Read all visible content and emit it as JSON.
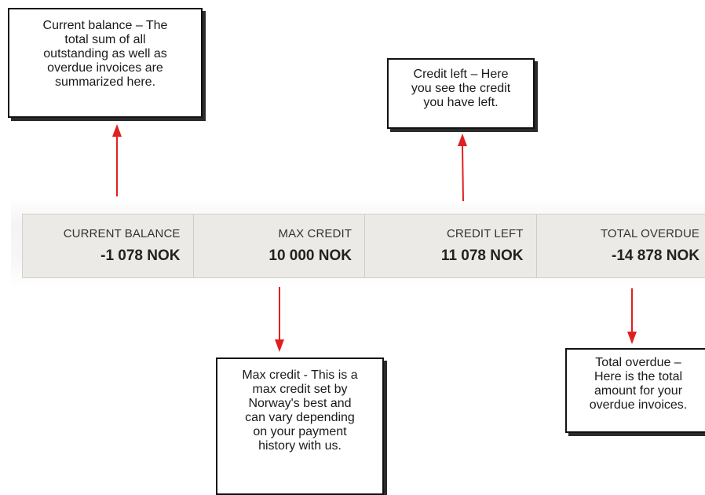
{
  "callouts": {
    "current_balance": "Current  balance – The\ntotal sum of all\noutstanding as well as\noverdue invoices are\nsummarized here.",
    "credit_left": "Credit left – Here\nyou see the credit\nyou have left.",
    "max_credit": "Max credit - This is a\nmax credit set by\nNorway's best and\ncan vary depending\non your payment\nhistory with us.",
    "total_overdue": "Total overdue –\nHere is the total\namount for your\noverdue invoices."
  },
  "summary": [
    {
      "label": "CURRENT BALANCE",
      "value": "-1 078 NOK"
    },
    {
      "label": "MAX CREDIT",
      "value": "10 000 NOK"
    },
    {
      "label": "CREDIT LEFT",
      "value": "11 078 NOK"
    },
    {
      "label": "TOTAL OVERDUE",
      "value": "-14 878 NOK"
    }
  ],
  "colors": {
    "arrow": "#e02020",
    "panel": "#eceae6",
    "callout_border": "#111111"
  }
}
